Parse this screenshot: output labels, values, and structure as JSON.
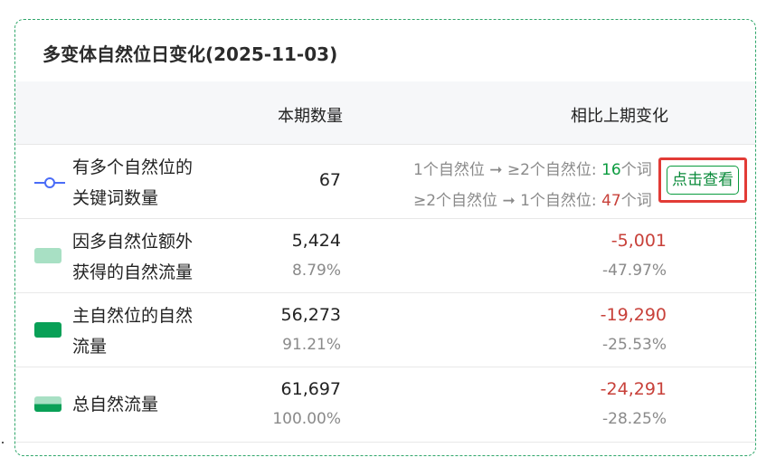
{
  "panel": {
    "title": "多变体自然位日变化(2025-11-03)"
  },
  "table": {
    "headers": {
      "count": "本期数量",
      "change": "相比上期变化"
    },
    "rows": [
      {
        "label": "有多个自然位的关键词数量",
        "value": "67",
        "transitions": [
          {
            "text": "1个自然位 ➞ ≥2个自然位: ",
            "count": "16",
            "suffix": "个词"
          },
          {
            "text": "≥2个自然位 ➞ 1个自然位: ",
            "count": "47",
            "suffix": "个词"
          }
        ],
        "action_label": "点击查看"
      },
      {
        "label": "因多自然位额外获得的自然流量",
        "value": "5,424",
        "pct": "8.79%",
        "change": "-5,001",
        "change_pct": "-47.97%"
      },
      {
        "label": "主自然位的自然流量",
        "value": "56,273",
        "pct": "91.21%",
        "change": "-19,290",
        "change_pct": "-25.53%"
      },
      {
        "label": "总自然流量",
        "value": "61,697",
        "pct": "100.00%",
        "change": "-24,291",
        "change_pct": "-28.25%"
      }
    ]
  },
  "colors": {
    "light_green": "#a8e0c4",
    "green": "#09a057",
    "negative": "#c8413a",
    "positive": "#0a9b3e",
    "highlight_border": "#e23b36",
    "line_marker": "#4a6cf7"
  },
  "icons": {
    "row1": "line-circle-marker-icon",
    "row2": "light-green-swatch",
    "row3": "green-swatch",
    "row4": "split-green-swatch"
  }
}
